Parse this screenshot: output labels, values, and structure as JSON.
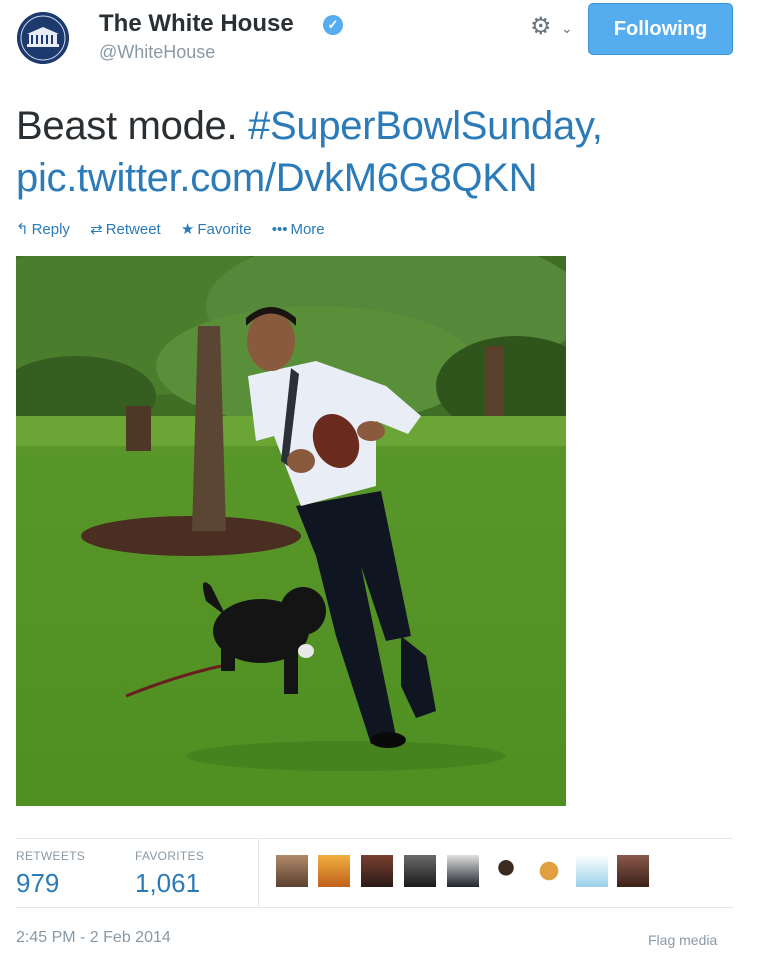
{
  "header": {
    "display_name": "The White House",
    "handle": "@WhiteHouse",
    "verified_icon": "verified-badge-icon",
    "settings_icon": "gear-icon",
    "follow_button_label": "Following"
  },
  "tweet": {
    "text_plain": "Beast mode. ",
    "hashtag": "#SuperBowlSunday",
    "comma": ",",
    "link": "pic.twitter.com/DvkM6G8QKN"
  },
  "actions": [
    {
      "label": "Reply",
      "icon": "reply-icon"
    },
    {
      "label": "Retweet",
      "icon": "retweet-icon"
    },
    {
      "label": "Favorite",
      "icon": "star-icon"
    },
    {
      "label": "More",
      "icon": "more-dots-icon"
    }
  ],
  "stats": {
    "retweets_label": "RETWEETS",
    "retweets_value": "979",
    "favorites_label": "FAVORITES",
    "favorites_value": "1,061"
  },
  "timestamp": "2:45 PM - 2 Feb 2014",
  "flag_media": "Flag media",
  "colors": {
    "accent": "#55acee",
    "link": "#2b7bb9",
    "muted": "#8899a6"
  }
}
